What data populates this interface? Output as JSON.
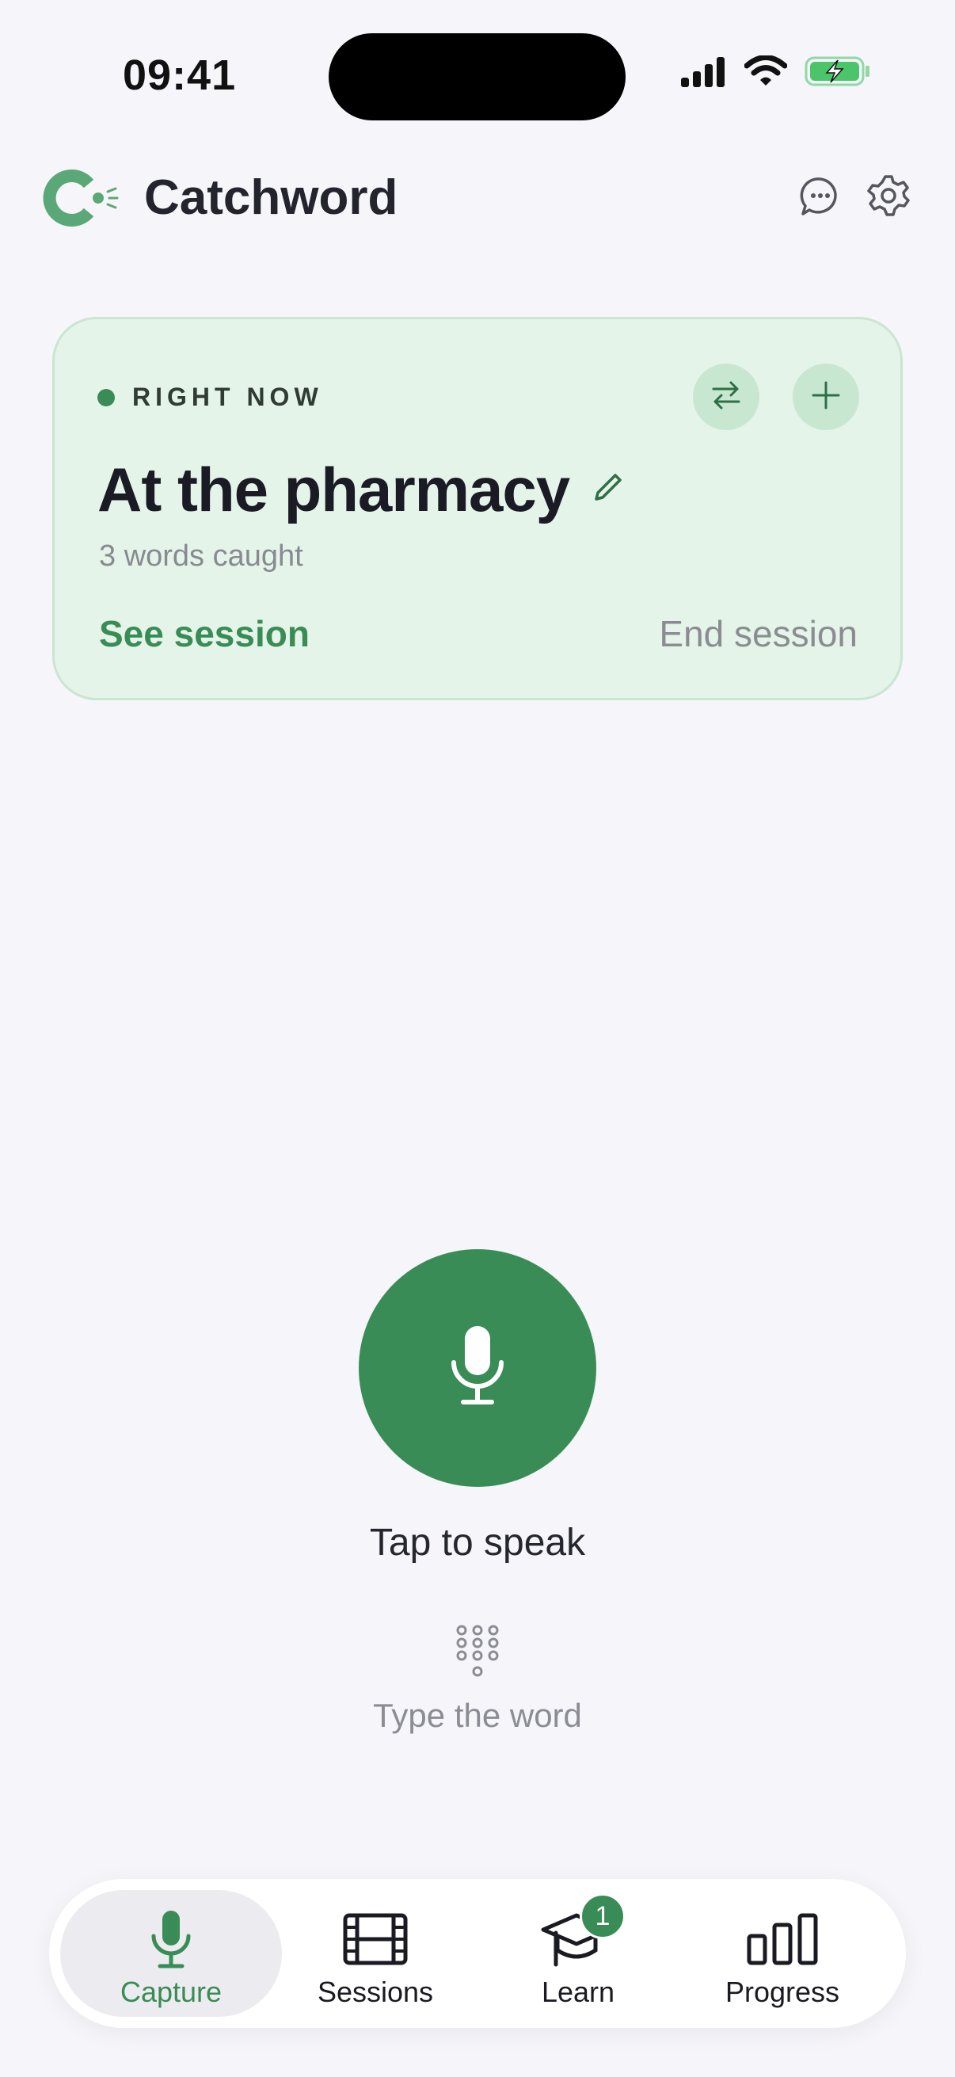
{
  "status_bar": {
    "time": "09:41",
    "icons": [
      "cellular-signal-icon",
      "wifi-icon",
      "battery-charging-icon"
    ]
  },
  "header": {
    "app_name": "Catchword",
    "logo_icon": "catchword-logo-icon",
    "actions": [
      "chat-bubble-icon",
      "gear-icon"
    ]
  },
  "session_card": {
    "live_label": "RIGHT NOW",
    "title": "At the pharmacy",
    "subtitle": "3 words caught",
    "primary_action": "See session",
    "secondary_action": "End session",
    "icon_buttons": [
      "swap-icon",
      "plus-icon",
      "pencil-icon"
    ]
  },
  "capture": {
    "mic_icon": "microphone-icon",
    "tap_label": "Tap to speak",
    "keypad_icon": "keypad-icon",
    "type_label": "Type the word"
  },
  "tab_bar": {
    "tabs": [
      {
        "label": "Capture",
        "icon": "microphone-icon",
        "active": true
      },
      {
        "label": "Sessions",
        "icon": "film-icon",
        "active": false
      },
      {
        "label": "Learn",
        "icon": "graduation-cap-icon",
        "active": false,
        "badge": "1"
      },
      {
        "label": "Progress",
        "icon": "bar-chart-icon",
        "active": false
      }
    ]
  },
  "colors": {
    "accent": "#3a8c56",
    "card_background": "#e5f4e9",
    "page_background": "#f6f5fa"
  }
}
